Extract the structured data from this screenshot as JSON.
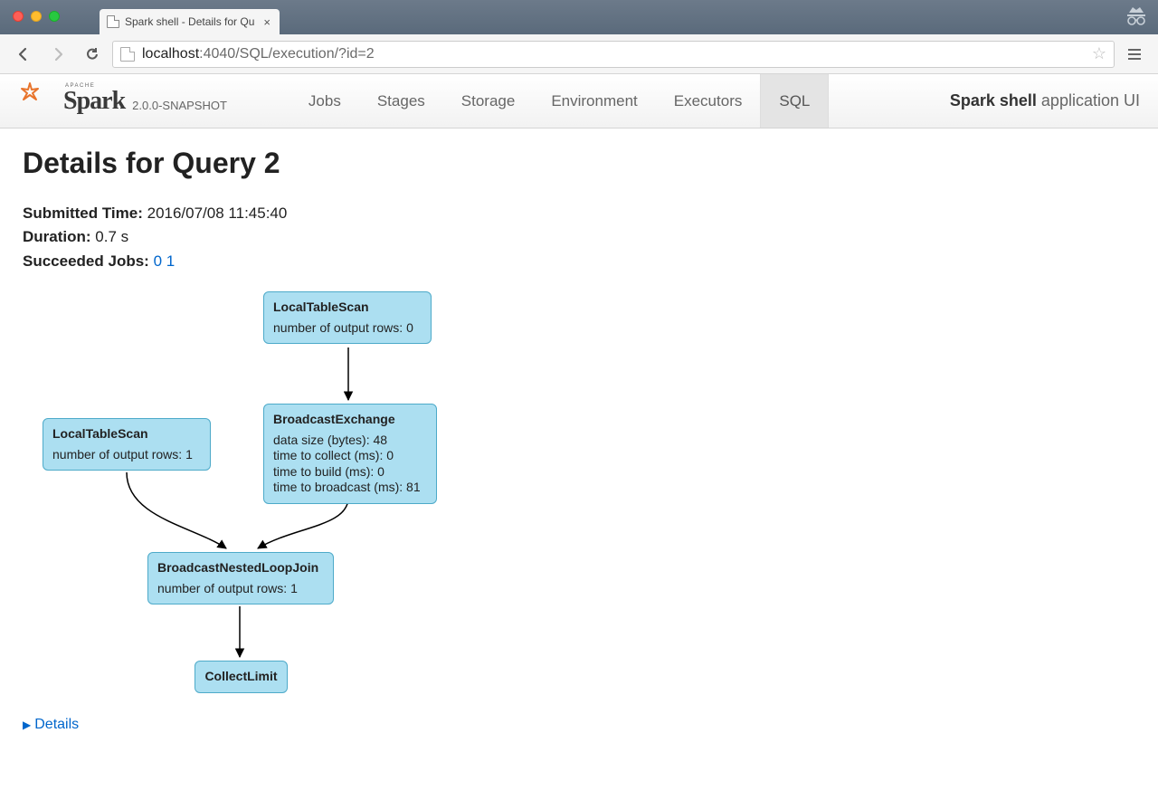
{
  "browser": {
    "tab_title": "Spark shell - Details for Qu",
    "url_host": "localhost",
    "url_port_path": ":4040/SQL/execution/?id=2"
  },
  "header": {
    "logo_text": "Spark",
    "version": "2.0.0-SNAPSHOT",
    "nav": {
      "jobs": "Jobs",
      "stages": "Stages",
      "storage": "Storage",
      "environment": "Environment",
      "executors": "Executors",
      "sql": "SQL"
    },
    "app_name_bold": "Spark shell",
    "app_name_rest": " application UI"
  },
  "page": {
    "title": "Details for Query 2",
    "submitted_label": "Submitted Time:",
    "submitted_value": "2016/07/08 11:45:40",
    "duration_label": "Duration:",
    "duration_value": "0.7 s",
    "succeeded_label": "Succeeded Jobs:",
    "succeeded_jobs": [
      "0",
      "1"
    ]
  },
  "dag": {
    "n0": {
      "title": "LocalTableScan",
      "line1": "number of output rows: 0"
    },
    "n1": {
      "title": "LocalTableScan",
      "line1": "number of output rows: 1"
    },
    "n2": {
      "title": "BroadcastExchange",
      "line1": "data size (bytes): 48",
      "line2": "time to collect (ms): 0",
      "line3": "time to build (ms): 0",
      "line4": "time to broadcast (ms): 81"
    },
    "n3": {
      "title": "BroadcastNestedLoopJoin",
      "line1": "number of output rows: 1"
    },
    "n4": {
      "title": "CollectLimit"
    }
  },
  "details_link": "Details"
}
